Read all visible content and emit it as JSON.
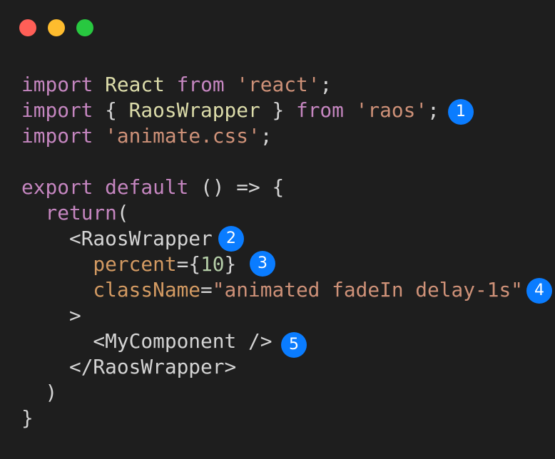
{
  "window": {
    "controls": [
      {
        "name": "close",
        "color": "#ff5f57"
      },
      {
        "name": "minimize",
        "color": "#febc2e"
      },
      {
        "name": "zoom",
        "color": "#28c840"
      }
    ]
  },
  "colors": {
    "background": "#1e1e1e",
    "keyword": "#c586c0",
    "identifier": "#dcdcaa",
    "string": "#ce9178",
    "punct": "#d4d4d4",
    "attr": "#d39a62",
    "number": "#b5cea8",
    "tag": "#d4d4d4",
    "badge": "#0a7cff"
  },
  "code": [
    [
      [
        "keyword",
        "import"
      ],
      [
        "punct",
        " "
      ],
      [
        "identifier",
        "React"
      ],
      [
        "punct",
        " "
      ],
      [
        "keyword",
        "from"
      ],
      [
        "punct",
        " "
      ],
      [
        "string",
        "'react'"
      ],
      [
        "punct",
        ";"
      ]
    ],
    [
      [
        "keyword",
        "import"
      ],
      [
        "punct",
        " { "
      ],
      [
        "identifier",
        "RaosWrapper"
      ],
      [
        "punct",
        " } "
      ],
      [
        "keyword",
        "from"
      ],
      [
        "punct",
        " "
      ],
      [
        "string",
        "'raos'"
      ],
      [
        "punct",
        ";"
      ]
    ],
    [
      [
        "keyword",
        "import"
      ],
      [
        "punct",
        " "
      ],
      [
        "string",
        "'animate.css'"
      ],
      [
        "punct",
        ";"
      ]
    ],
    [],
    [
      [
        "keyword",
        "export"
      ],
      [
        "punct",
        " "
      ],
      [
        "keyword",
        "default"
      ],
      [
        "punct",
        " () => {"
      ]
    ],
    [
      [
        "punct",
        "  "
      ],
      [
        "keyword",
        "return"
      ],
      [
        "punct",
        "("
      ]
    ],
    [
      [
        "punct",
        "    "
      ],
      [
        "tag",
        "<RaosWrapper"
      ]
    ],
    [
      [
        "punct",
        "      "
      ],
      [
        "attr",
        "percent"
      ],
      [
        "punct",
        "={"
      ],
      [
        "number",
        "10"
      ],
      [
        "punct",
        "}"
      ]
    ],
    [
      [
        "punct",
        "      "
      ],
      [
        "attr",
        "className"
      ],
      [
        "punct",
        "="
      ],
      [
        "string",
        "\"animated fadeIn delay-1s\""
      ]
    ],
    [
      [
        "punct",
        "    "
      ],
      [
        "tag",
        ">"
      ]
    ],
    [
      [
        "punct",
        "      "
      ],
      [
        "tag",
        "<MyComponent />"
      ]
    ],
    [
      [
        "punct",
        "    "
      ],
      [
        "tag",
        "</RaosWrapper>"
      ]
    ],
    [
      [
        "punct",
        "  )"
      ]
    ],
    [
      [
        "punct",
        "}"
      ]
    ]
  ],
  "badges": [
    "1",
    "2",
    "3",
    "4",
    "5"
  ]
}
